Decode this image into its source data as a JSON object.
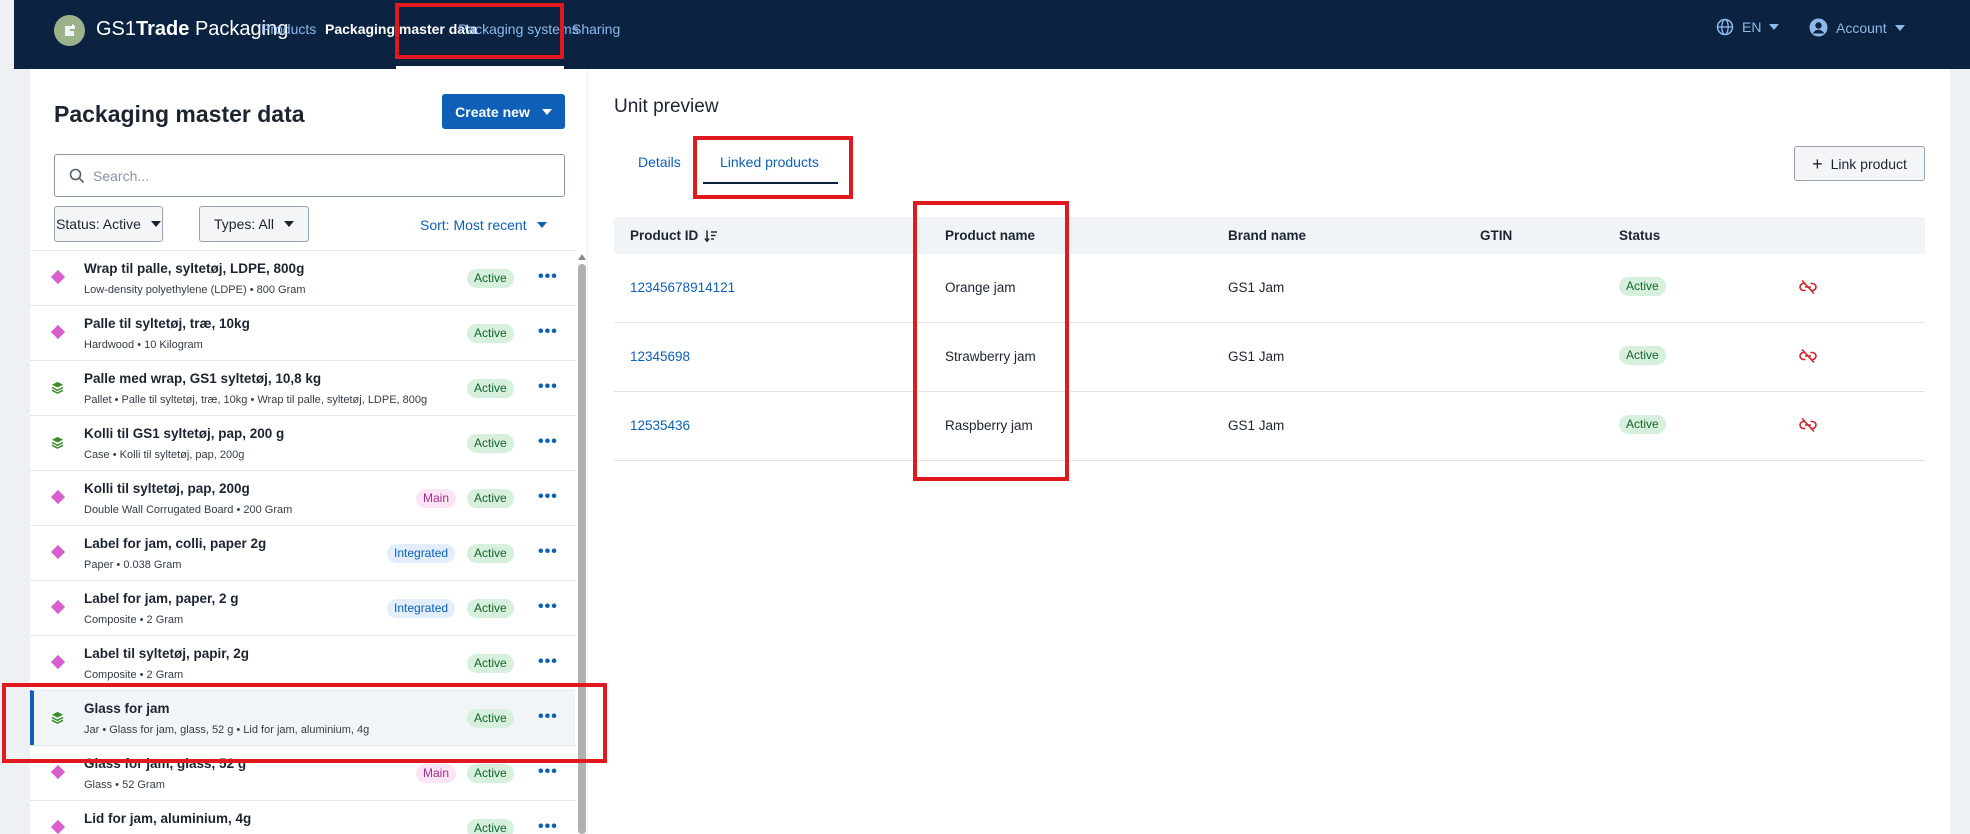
{
  "nav": {
    "brand_prefix": "GS1",
    "brand_bold": "Trade",
    "brand_suffix": " Packaging",
    "items": [
      "Products",
      "Packaging master data",
      "Packaging systems",
      "Sharing"
    ],
    "language": "EN",
    "account": "Account"
  },
  "left": {
    "title": "Packaging master data",
    "create_label": "Create new",
    "search_placeholder": "Search...",
    "status_filter": "Status: Active",
    "types_filter": "Types: All",
    "sort_label": "Sort: Most recent",
    "items": [
      {
        "icon": "diamond",
        "title": "Wrap til palle, syltetøj, LDPE, 800g",
        "sub": "Low-density polyethylene (LDPE) • 800 Gram",
        "tag": "",
        "status": "Active"
      },
      {
        "icon": "diamond",
        "title": "Palle til syltetøj, træ, 10kg",
        "sub": "Hardwood • 10 Kilogram",
        "tag": "",
        "status": "Active"
      },
      {
        "icon": "layers",
        "title": "Palle med wrap, GS1 syltetøj, 10,8 kg",
        "sub": "Pallet • Palle til syltetøj, træ, 10kg • Wrap til palle, syltetøj, LDPE, 800g",
        "tag": "",
        "status": "Active"
      },
      {
        "icon": "layers",
        "title": "Kolli til GS1 syltetøj, pap, 200 g",
        "sub": "Case • Kolli til syltetøj, pap, 200g",
        "tag": "",
        "status": "Active"
      },
      {
        "icon": "diamond",
        "title": "Kolli til syltetøj, pap, 200g",
        "sub": "Double Wall Corrugated Board • 200 Gram",
        "tag": "Main",
        "status": "Active"
      },
      {
        "icon": "diamond",
        "title": "Label for jam, colli, paper 2g",
        "sub": "Paper • 0.038 Gram",
        "tag": "Integrated",
        "status": "Active"
      },
      {
        "icon": "diamond",
        "title": "Label for jam, paper, 2 g",
        "sub": "Composite • 2 Gram",
        "tag": "Integrated",
        "status": "Active"
      },
      {
        "icon": "diamond",
        "title": "Label til syltetøj, papir, 2g",
        "sub": "Composite • 2 Gram",
        "tag": "",
        "status": "Active"
      },
      {
        "icon": "layers",
        "title": "Glass for jam",
        "sub": "Jar • Glass for jam, glass, 52 g • Lid for jam, aluminium, 4g",
        "tag": "",
        "status": "Active",
        "selected": true
      },
      {
        "icon": "diamond",
        "title": "Glass for jam, glass, 52 g",
        "sub": "Glass • 52 Gram",
        "tag": "Main",
        "status": "Active"
      },
      {
        "icon": "diamond",
        "title": "Lid for jam, aluminium, 4g",
        "sub": "",
        "tag": "",
        "status": "Active"
      }
    ]
  },
  "right": {
    "title": "Unit preview",
    "tabs": [
      "Details",
      "Linked products"
    ],
    "link_button": "Link product",
    "columns": [
      "Product ID",
      "Product name",
      "Brand name",
      "GTIN",
      "Status"
    ],
    "rows": [
      {
        "id": "12345678914121",
        "name": "Orange jam",
        "brand": "GS1 Jam",
        "gtin": "",
        "status": "Active"
      },
      {
        "id": "12345698",
        "name": "Strawberry jam",
        "brand": "GS1 Jam",
        "gtin": "",
        "status": "Active"
      },
      {
        "id": "12535436",
        "name": "Raspberry jam",
        "brand": "GS1 Jam",
        "gtin": "",
        "status": "Active"
      }
    ]
  },
  "colors": {
    "nav_bg": "#0b2240",
    "primary": "#0d5fb8",
    "highlight": "#e0191f",
    "diamond": "#d85fcf",
    "layers": "#3c8c2c"
  }
}
